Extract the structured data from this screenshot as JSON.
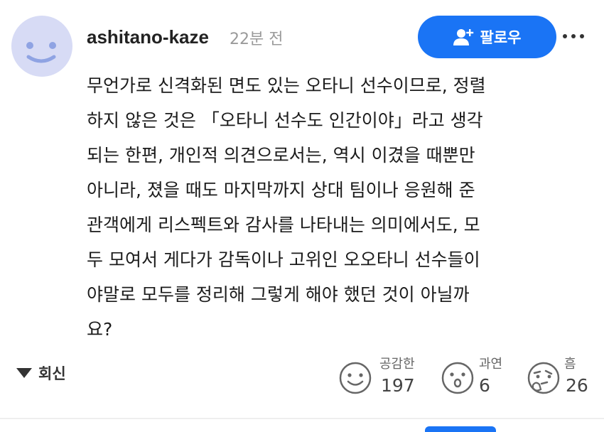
{
  "comment": {
    "username": "ashitano-kaze",
    "time_ago": "22분 전",
    "follow_label": "팔로우",
    "body_lines": [
      "무언가로 신격화된 면도 있는 오타니 선수이므로, 정렬",
      "하지 않은 것은 「오타니 선수도 인간이야」라고 생각",
      "되는 한편, 개인적 의견으로서는, 역시 이겼을 때뿐만",
      "아니라, 졌을 때도 마지막까지 상대 팀이나 응원해 준",
      "관객에게 리스펙트와 감사를 나타내는 의미에서도, 모",
      "두 모여서 게다가 감독이나 고위인 오오타니 선수들이",
      "야말로 모두를 정리해 그렇게 해야 했던 것이 아닐까",
      "요?"
    ],
    "reply_label": "회신",
    "reactions": [
      {
        "label": "공감한",
        "count": "197",
        "icon": "smile-face-icon"
      },
      {
        "label": "과연",
        "count": "6",
        "icon": "surprised-face-icon"
      },
      {
        "label": "흠",
        "count": "26",
        "icon": "thinking-face-icon"
      }
    ]
  },
  "colors": {
    "accent": "#1a74f5",
    "avatar_bg": "#d7dbf5",
    "avatar_face": "#8fa3e3",
    "muted": "#9a9a9a"
  }
}
